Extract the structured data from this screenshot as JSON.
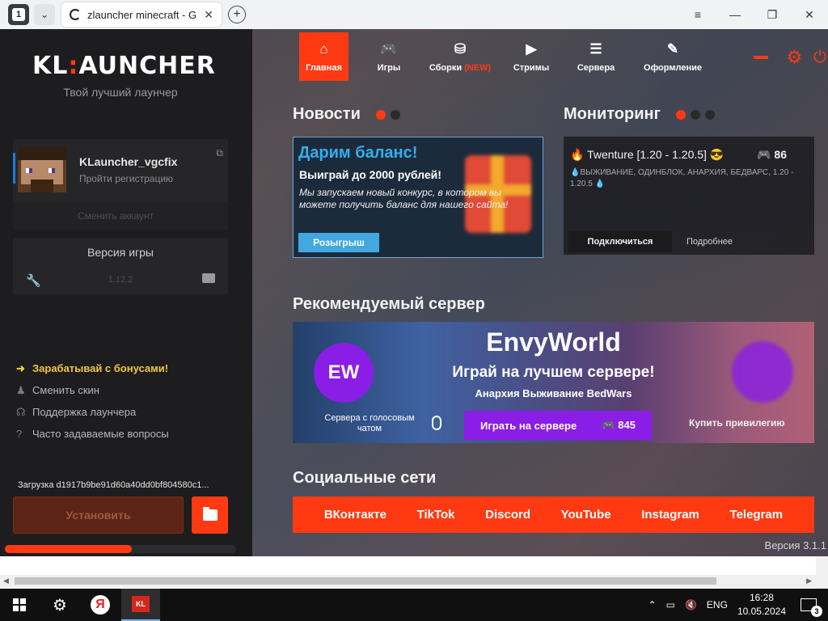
{
  "browser": {
    "tab_count": "1",
    "tab_title": "zlauncher minecraft - G",
    "close": "✕",
    "new_tab": "+",
    "menu": "≡",
    "minimize": "—",
    "restore": "❐",
    "close_window": "✕"
  },
  "sidebar": {
    "logo_left": "KL",
    "logo_colon": ":",
    "logo_right": "AUNCHER",
    "tagline": "Твой лучший лаунчер",
    "account": {
      "name": "KLauncher_vgcfix",
      "subtitle": "Пройти регистрацию",
      "switch": "Сменить аккаунт"
    },
    "version": {
      "title": "Версия игры",
      "value": "1.12.2"
    },
    "menu": [
      {
        "icon": "➜",
        "label": "Зарабатывай с бонусами!"
      },
      {
        "icon": "♟",
        "label": "Сменить скин"
      },
      {
        "icon": "☊",
        "label": "Поддержка лаунчера"
      },
      {
        "icon": "?",
        "label": "Часто задаваемые вопросы"
      }
    ],
    "download_text": "Загрузка d1917b9be91d60a40dd0bf804580c1...",
    "install_label": "Установить",
    "progress": 0.55
  },
  "nav": {
    "items": [
      {
        "icon": "⌂",
        "label": "Главная"
      },
      {
        "icon": "🎮",
        "label": "Игры"
      },
      {
        "icon": "⛁",
        "label": "Сборки",
        "badge": "(NEW)"
      },
      {
        "icon": "▶",
        "label": "Стримы"
      },
      {
        "icon": "☰",
        "label": "Сервера"
      },
      {
        "icon": "✎",
        "label": "Оформление"
      }
    ]
  },
  "news": {
    "title": "Новости",
    "heading": "Дарим баланс!",
    "subheading": "Выиграй до 2000 рублей!",
    "body": "Мы запускаем новый конкурс, в котором вы можете получить баланс для нашего сайта!",
    "button": "Розыгрыш"
  },
  "monitoring": {
    "title": "Мониторинг",
    "server": "🔥 Twenture [1.20 - 1.20.5] 😎",
    "players": "🎮 86",
    "tags": "💧ВЫЖИВАНИЕ, ОДИНБЛОК, АНАРХИЯ, БЕДВАРС, 1.20 - 1.20.5 💧",
    "connect": "Подключиться",
    "more": "Подробнее"
  },
  "recommended": {
    "title": "Рекомендуемый сервер",
    "logo": "EW",
    "name": "EnvyWorld",
    "slogan": "Играй на лучшем сервере!",
    "modes": "Анархия Выживание BedWars",
    "voice": "Сервера с голосовым чатом",
    "play": "Играть на сервере",
    "online": "🎮 845",
    "buy": "Купить привилегию"
  },
  "social": {
    "title": "Социальные сети",
    "links": [
      "ВКонтакте",
      "TikTok",
      "Discord",
      "YouTube",
      "Instagram",
      "Telegram"
    ]
  },
  "app_version": "Версия 3.1.1",
  "taskbar": {
    "lang": "ENG",
    "time": "16:28",
    "date": "10.05.2024",
    "notifications": "3",
    "kl_label": "KL",
    "yandex_label": "Я"
  },
  "colors": {
    "accent": "#ff3a12",
    "sidebar": "#1d1d1f",
    "news_heading": "#31b0f0",
    "server_purple": "#8a1ee6",
    "bonus_yellow": "#f4c542"
  }
}
